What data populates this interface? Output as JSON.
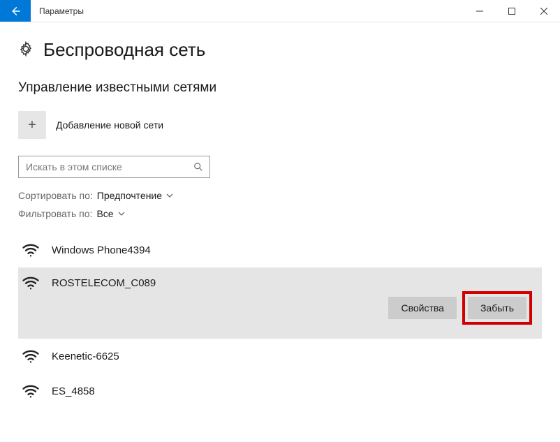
{
  "titlebar": {
    "title": "Параметры"
  },
  "page": {
    "heading": "Беспроводная сеть",
    "subheading": "Управление известными сетями",
    "add_label": "Добавление новой сети"
  },
  "search": {
    "placeholder": "Искать в этом списке"
  },
  "sort": {
    "label": "Сортировать по:",
    "value": "Предпочтение"
  },
  "filter": {
    "label": "Фильтровать по:",
    "value": "Все"
  },
  "networks": [
    {
      "name": "Windows Phone4394"
    },
    {
      "name": "ROSTELECOM_C089"
    },
    {
      "name": "Keenetic-6625"
    },
    {
      "name": "ES_4858"
    }
  ],
  "actions": {
    "properties": "Свойства",
    "forget": "Забыть"
  }
}
